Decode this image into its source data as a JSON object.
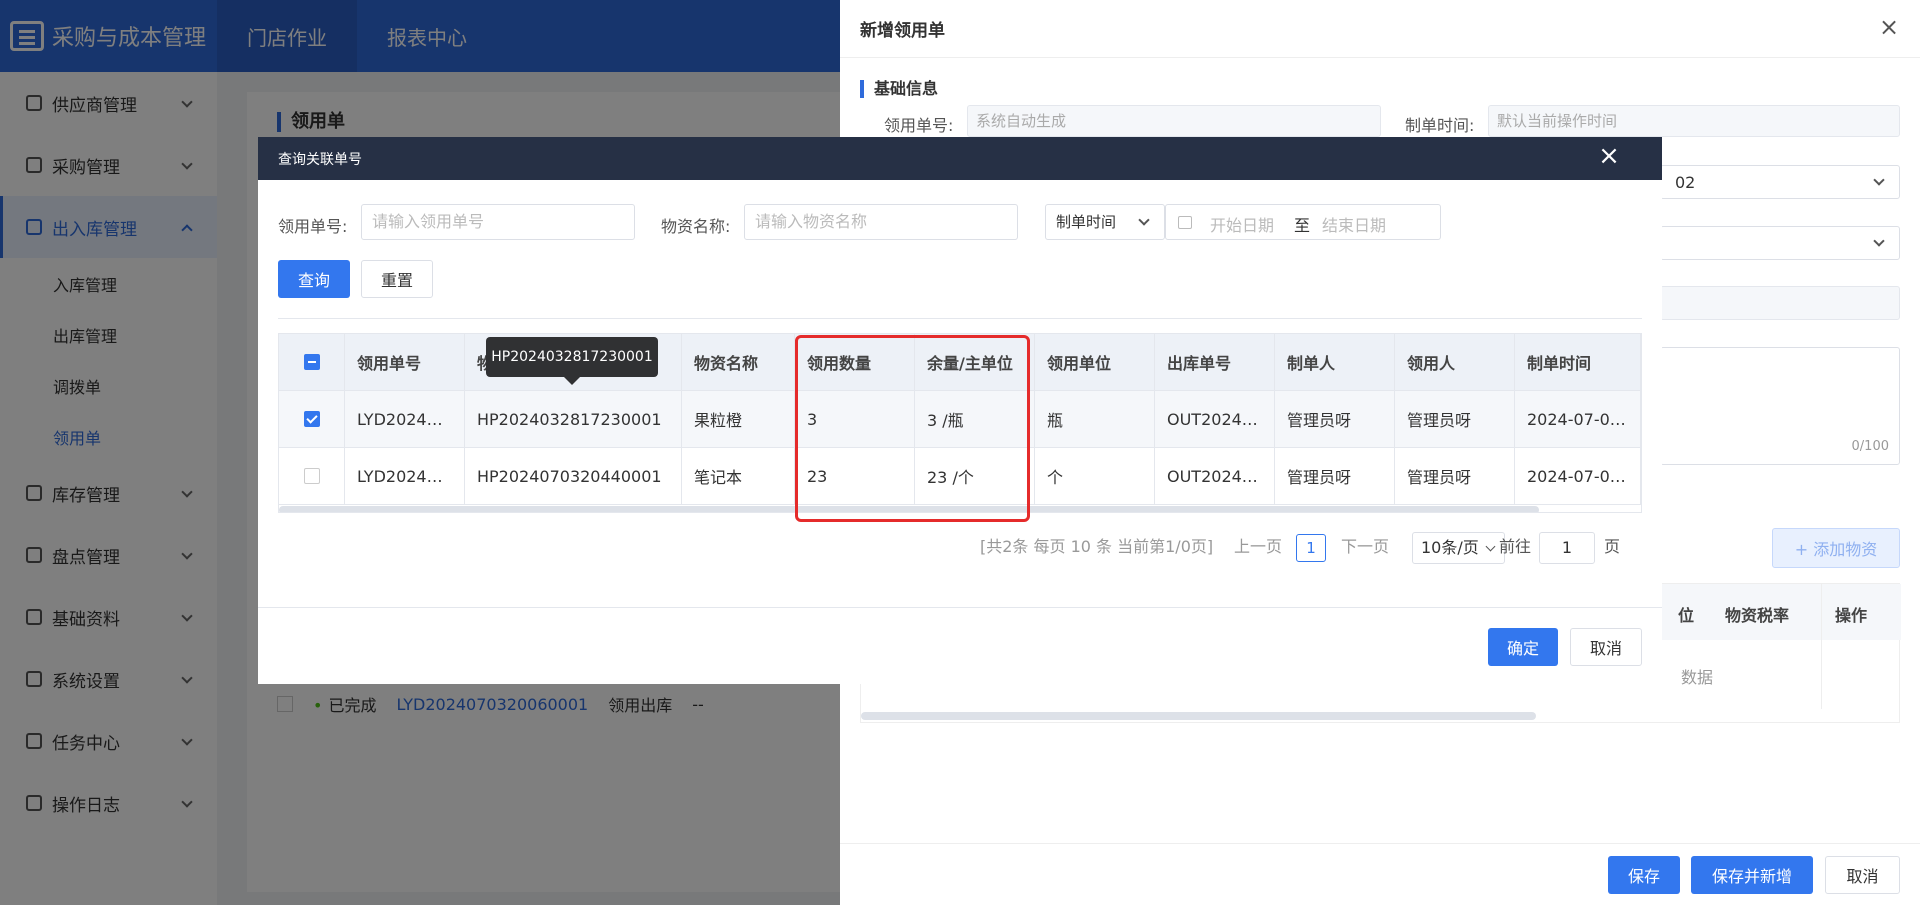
{
  "app": {
    "title": "采购与成本管理"
  },
  "topnav": [
    "门店作业",
    "报表中心"
  ],
  "sidebar": {
    "items": [
      {
        "label": "供应商管理"
      },
      {
        "label": "采购管理"
      },
      {
        "label": "出入库管理"
      },
      {
        "label": "库存管理"
      },
      {
        "label": "盘点管理"
      },
      {
        "label": "基础资料"
      },
      {
        "label": "系统设置"
      },
      {
        "label": "任务中心"
      },
      {
        "label": "操作日志"
      }
    ],
    "subitems": [
      "入库管理",
      "出库管理",
      "调拨单",
      "领用单"
    ]
  },
  "page": {
    "title": "领用单",
    "row": {
      "status": "已完成",
      "code": "LYD2024070320060001",
      "type": "领用出库",
      "extra": "--"
    }
  },
  "drawer": {
    "title": "新增领用单",
    "section": "基础信息",
    "code_label": "领用单号:",
    "code_placeholder": "系统自动生成",
    "time_label": "制单时间:",
    "time_placeholder": "默认当前操作时间",
    "select1_value": "02",
    "counter": "0/100",
    "add_button": "+ 添加物资",
    "table_headers": [
      "位",
      "物资税率",
      "操作"
    ],
    "empty_text": "数据",
    "save": "保存",
    "save_new": "保存并新增",
    "cancel": "取消"
  },
  "modal": {
    "title": "查询关联单号",
    "filters": {
      "code_label": "领用单号:",
      "code_placeholder": "请输入领用单号",
      "name_label": "物资名称:",
      "name_placeholder": "请输入物资名称",
      "time_type": "制单时间",
      "start_placeholder": "开始日期",
      "to": "至",
      "end_placeholder": "结束日期"
    },
    "query_button": "查询",
    "reset_button": "重置",
    "table": {
      "headers": [
        "领用单号",
        "物资编码",
        "物资名称",
        "领用数量",
        "余量/主单位",
        "领用单位",
        "出库单号",
        "制单人",
        "领用人",
        "制单时间"
      ],
      "rows": [
        [
          "LYD2024…",
          "HP2024032817230001",
          "果粒橙",
          "3",
          "3 /瓶",
          "瓶",
          "OUT2024…",
          "管理员呀",
          "管理员呀",
          "2024-07-0…"
        ],
        [
          "LYD2024…",
          "HP2024070320440001",
          "笔记本",
          "23",
          "23 /个",
          "个",
          "OUT2024…",
          "管理员呀",
          "管理员呀",
          "2024-07-0…"
        ]
      ],
      "row_checked": [
        true,
        false
      ]
    },
    "tooltip": "HP2024032817230001",
    "pager": {
      "summary": "[共2条 每页 10 条 当前第1/0页]",
      "prev": "上一页",
      "current": "1",
      "next": "下一页",
      "size": "10条/页",
      "goto": "前往",
      "goto_value": "1",
      "page_unit": "页"
    },
    "ok": "确定",
    "cancel": "取消"
  }
}
